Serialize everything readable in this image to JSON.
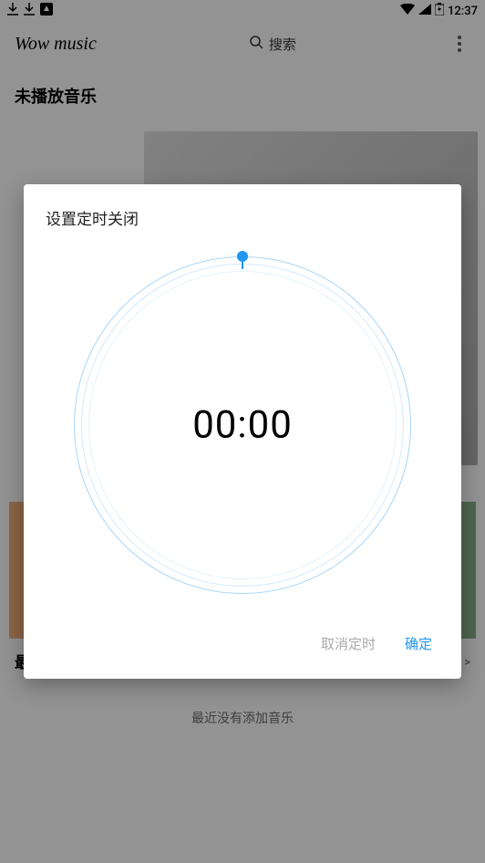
{
  "status_bar": {
    "time": "12:37"
  },
  "app": {
    "title": "Wow music",
    "search_label": "搜索"
  },
  "main": {
    "not_playing_title": "未播放音乐",
    "recent_title": "最近添加",
    "more_link": "更多 >",
    "empty_text": "最近没有添加音乐"
  },
  "modal": {
    "title": "设置定时关闭",
    "time_display": "00:00",
    "cancel_label": "取消定时",
    "confirm_label": "确定"
  }
}
